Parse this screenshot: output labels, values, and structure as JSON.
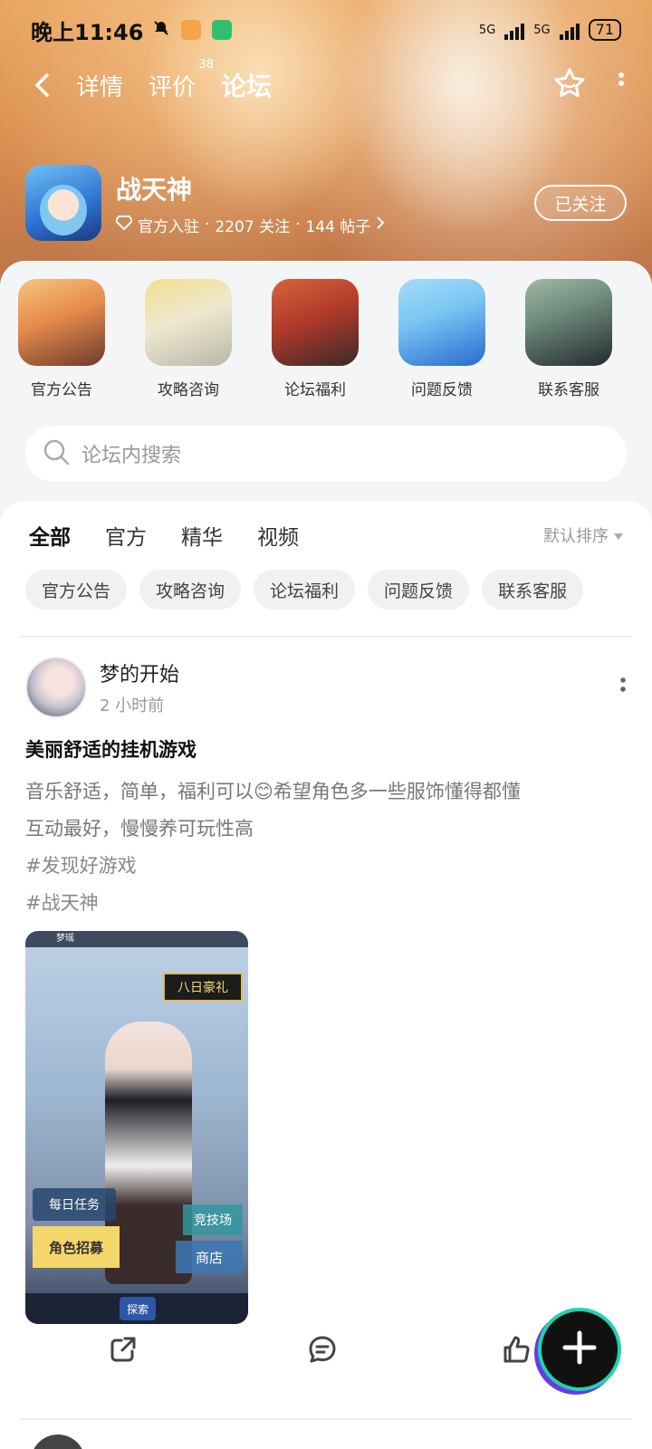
{
  "status_bar": {
    "time": "晚上11:46",
    "network_1": "5G",
    "network_2": "5G",
    "battery": "71"
  },
  "nav": {
    "tabs": [
      {
        "label": "详情"
      },
      {
        "label": "评价",
        "badge": "38"
      },
      {
        "label": "论坛"
      }
    ]
  },
  "game": {
    "name": "战天神",
    "verified": "官方入驻",
    "followers": "2207 关注",
    "posts": "144 帖子",
    "separator": "·",
    "follow_button": "已关注"
  },
  "categories": [
    {
      "label": "官方公告",
      "icon": "fox-girl-avatar",
      "color1": "#f2b26b",
      "color2": "#6d3a2c"
    },
    {
      "label": "攻略咨询",
      "icon": "white-hair-avatar",
      "color1": "#f3df8c",
      "color2": "#b8b8a8"
    },
    {
      "label": "论坛福利",
      "icon": "red-dress-avatar",
      "color1": "#b23a2a",
      "color2": "#3a2a26"
    },
    {
      "label": "问题反馈",
      "icon": "blue-hair-avatar",
      "color1": "#7bc7f3",
      "color2": "#2a6ad0"
    },
    {
      "label": "联系客服",
      "icon": "dark-hair-avatar",
      "color1": "#6d8a7a",
      "color2": "#242a30"
    }
  ],
  "search": {
    "placeholder": "论坛内搜索"
  },
  "feed_tabs": [
    "全部",
    "官方",
    "精华",
    "视频"
  ],
  "sort_label": "默认排序",
  "chips": [
    "官方公告",
    "攻略咨询",
    "论坛福利",
    "问题反馈",
    "联系客服"
  ],
  "post": {
    "author": "梦的开始",
    "time": "2 小时前",
    "title": "美丽舒适的挂机游戏",
    "body_line1": "音乐舒适，简单，福利可以😊希望角色多一些服饰懂得都懂",
    "body_line2": "互动最好，慢慢养可玩性高",
    "tags": [
      "#发现好游戏",
      "#战天神"
    ],
    "screenshot": {
      "player": "梦瑶",
      "banner": "八日豪礼",
      "daily_task": "每日任务",
      "recruit": "角色招募",
      "arena": "竞技场",
      "shop": "商店",
      "explore": "探索"
    }
  },
  "colors": {
    "accent": "#1fd3b0",
    "fab_ring": "#6b3be0"
  }
}
